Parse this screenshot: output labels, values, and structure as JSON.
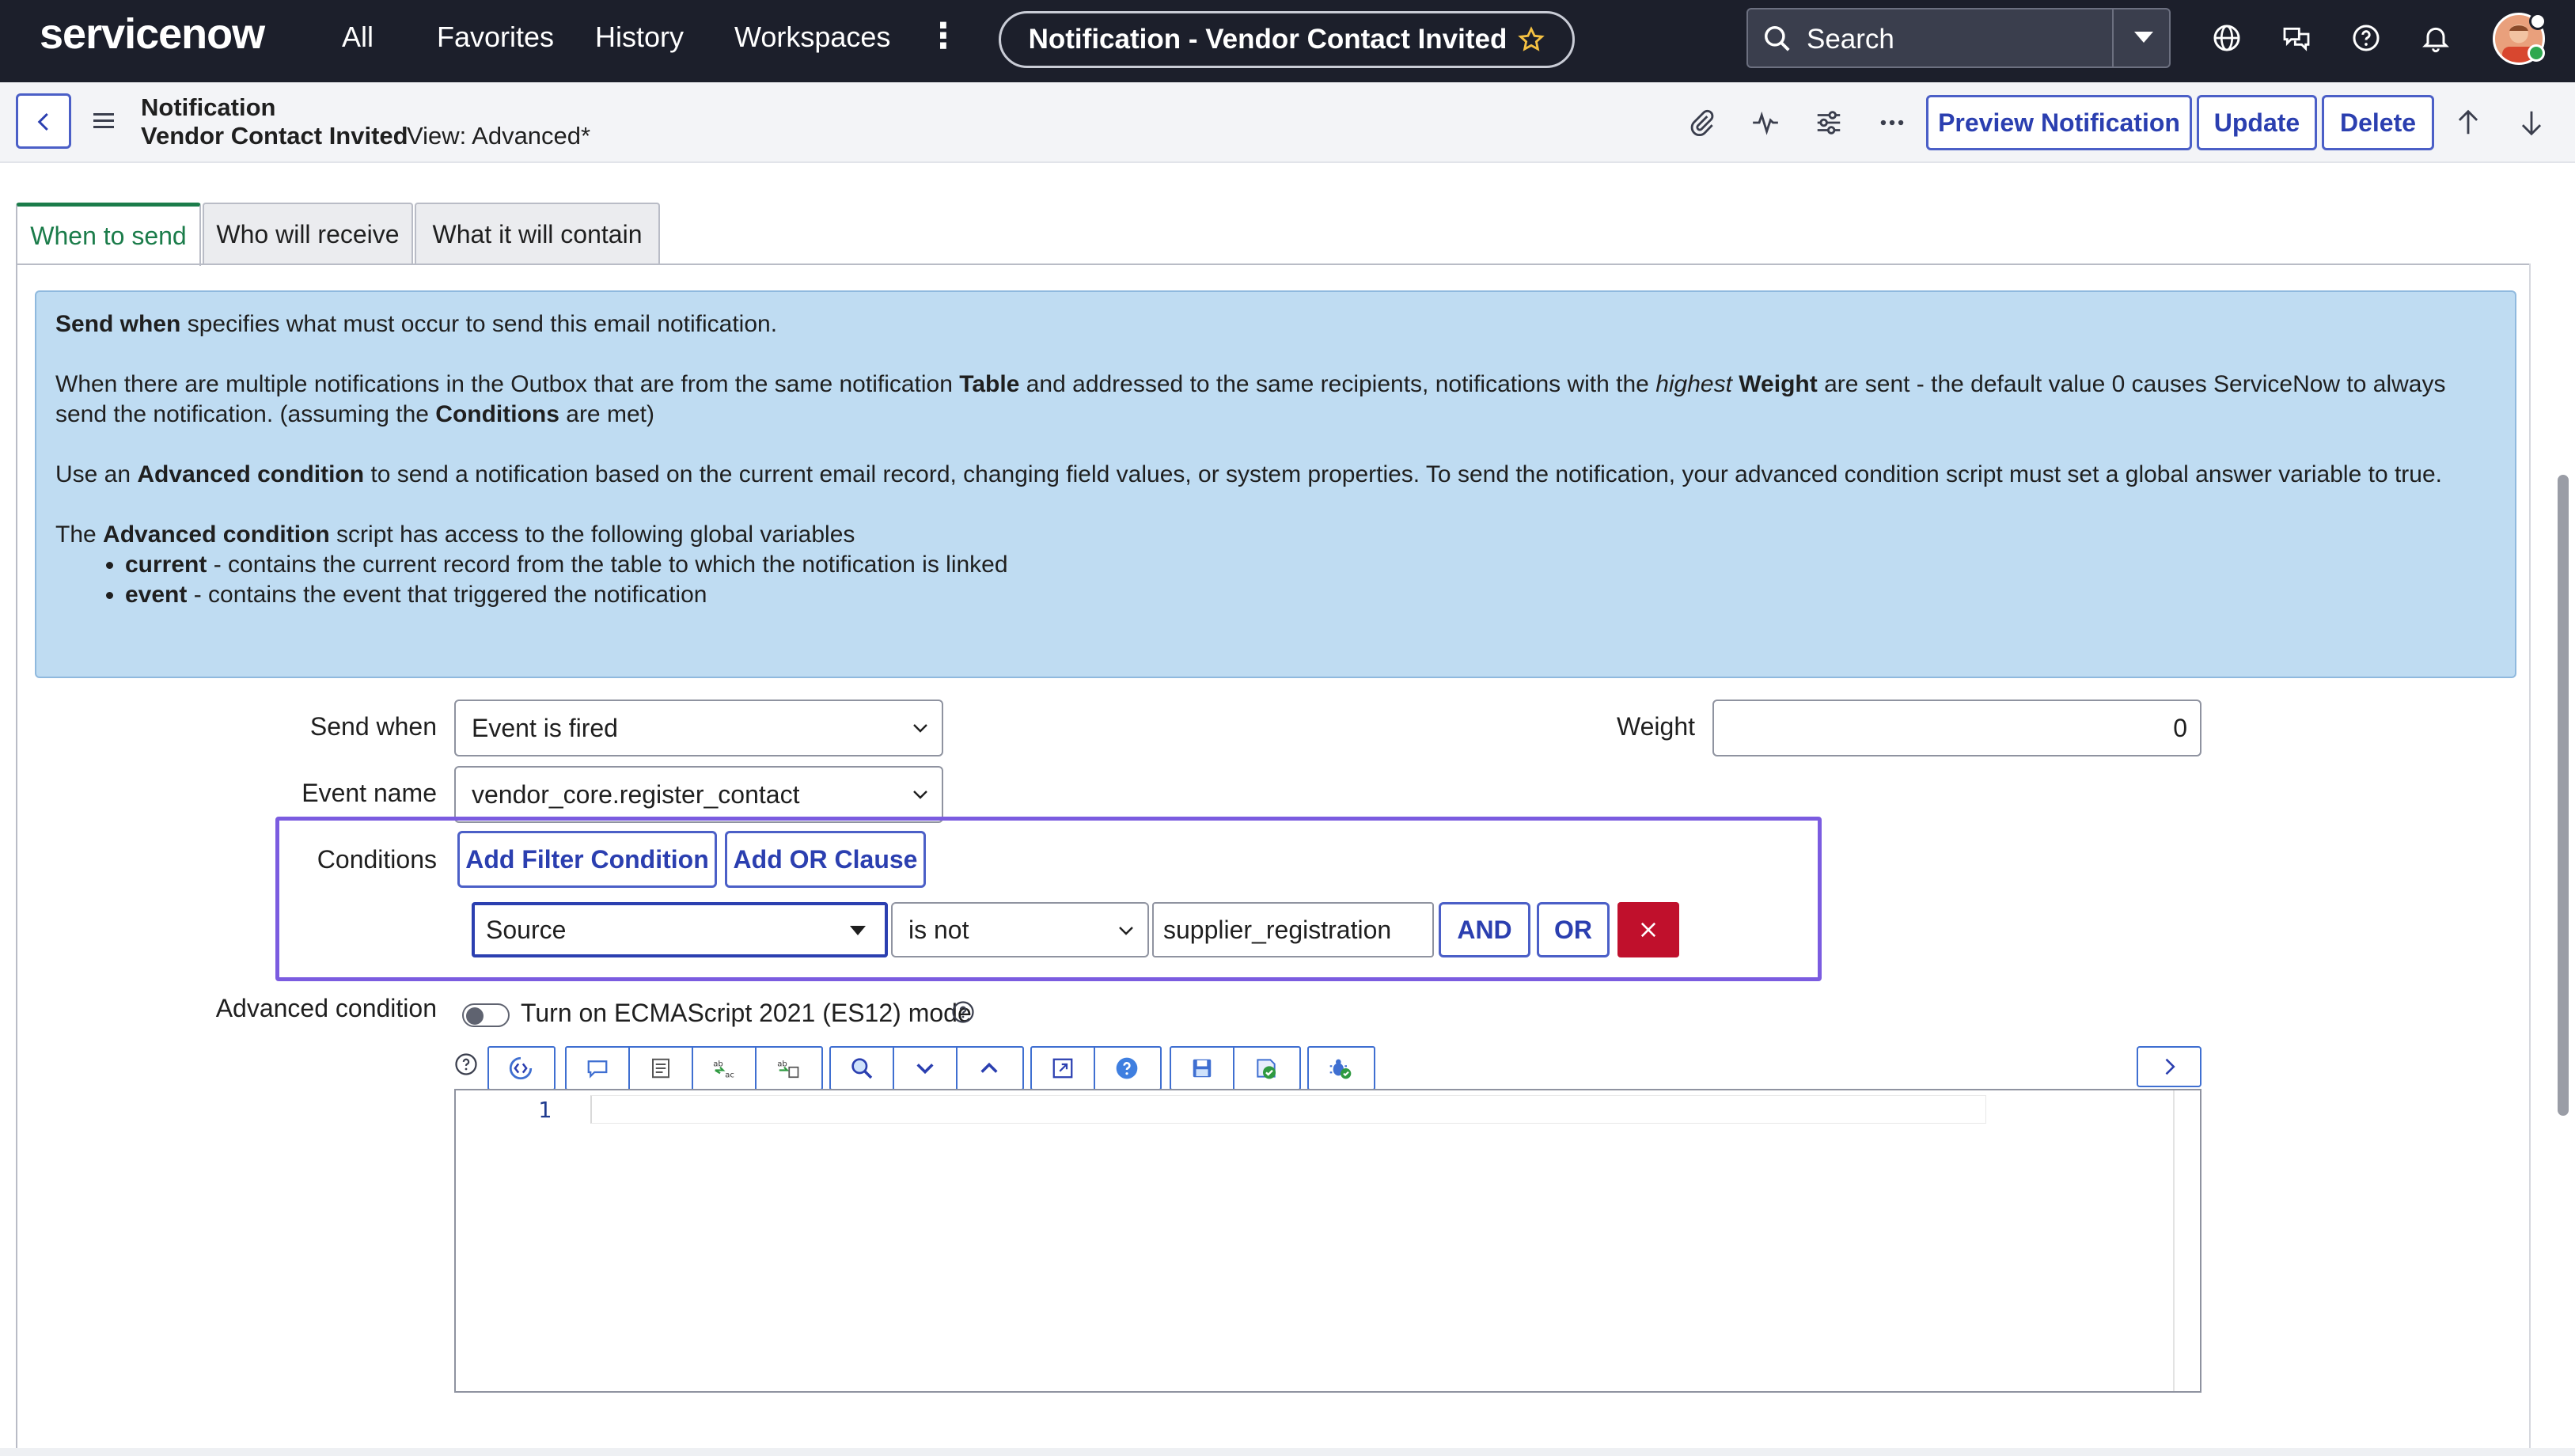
{
  "topnav": {
    "logo": "servicenow",
    "links": [
      "All",
      "Favorites",
      "History",
      "Workspaces"
    ],
    "more_icon": "vertical-ellipsis-icon",
    "record_title": "Notification - Vendor Contact Invited",
    "search_placeholder": "Search",
    "icons": [
      "globe-icon",
      "chat-icon",
      "help-icon",
      "bell-icon"
    ]
  },
  "header": {
    "record_type": "Notification",
    "record_name": "Vendor Contact Invited",
    "view_label": "View: Advanced*",
    "buttons": {
      "preview": "Preview Notification",
      "update": "Update",
      "delete": "Delete"
    },
    "icons": [
      "paperclip-icon",
      "activity-icon",
      "sliders-icon",
      "more-horizontal-icon",
      "arrow-up-icon",
      "arrow-down-icon"
    ]
  },
  "tabs": [
    {
      "label": "When to send",
      "active": true
    },
    {
      "label": "Who will receive",
      "active": false
    },
    {
      "label": "What it will contain",
      "active": false
    }
  ],
  "info": {
    "p1_bold": "Send when",
    "p1_rest": " specifies what must occur to send this email notification.",
    "p2_a": "When there are multiple notifications in the Outbox that are from the same notification ",
    "p2_table": "Table",
    "p2_b": " and addressed to the same recipients, notifications with the ",
    "p2_highest": "highest",
    "p2_weight": " Weight",
    "p2_c": " are sent - the default value 0 causes ServiceNow to always send the notification. (assuming the ",
    "p2_conditions": "Conditions",
    "p2_d": " are met)",
    "p3_a": "Use an ",
    "p3_bold": "Advanced condition",
    "p3_b": " to send a notification based on the current email record, changing field values, or system properties. To send the notification, your advanced condition script must set a global answer variable to true.",
    "p4_a": "The ",
    "p4_bold": "Advanced condition",
    "p4_b": " script has access to the following global variables",
    "li1_bold": "current",
    "li1_rest": " - contains the current record from the table to which the notification is linked",
    "li2_bold": "event",
    "li2_rest": " - contains the event that triggered the notification"
  },
  "form": {
    "send_when_label": "Send when",
    "send_when_value": "Event is fired",
    "weight_label": "Weight",
    "weight_value": "0",
    "event_name_label": "Event name",
    "event_name_value": "vendor_core.register_contact",
    "conditions_label": "Conditions",
    "add_filter_condition": "Add Filter Condition",
    "add_or_clause": "Add OR Clause",
    "condition": {
      "field": "Source",
      "operator": "is not",
      "value": "supplier_registration",
      "and_label": "AND",
      "or_label": "OR"
    },
    "advanced_condition_label": "Advanced condition",
    "es12_label": "Turn on ECMAScript 2021 (ES12) mode",
    "editor_line_number": "1"
  },
  "colors": {
    "nav_bg": "#1c1f2b",
    "accent_blue": "#2b3fb0",
    "active_tab": "#1b7c4a",
    "info_bg": "#bfdcf2",
    "conditions_highlight": "#7b5ce0",
    "delete_red": "#c0102c"
  }
}
